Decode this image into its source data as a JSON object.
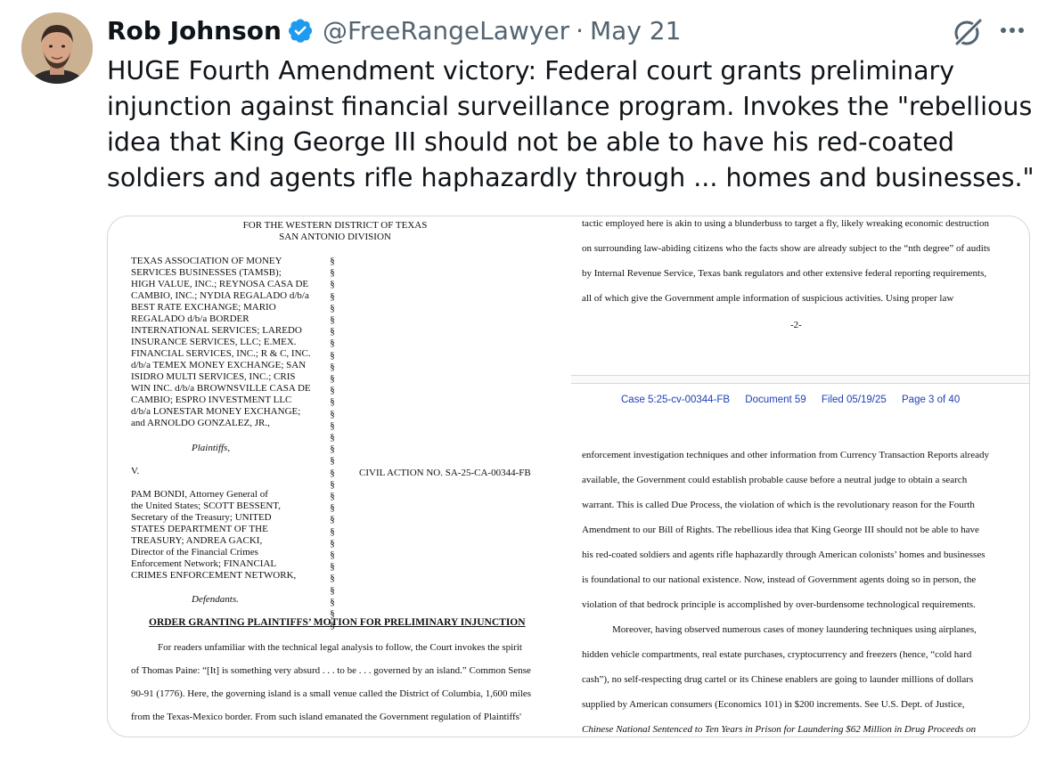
{
  "tweet": {
    "author_name": "Rob Johnson",
    "handle": "@FreeRangeLawyer",
    "separator": "·",
    "date": "May 21",
    "text": "HUGE Fourth Amendment victory: Federal court grants preliminary injunction against financial surveillance program. Invokes the \"rebellious idea that King George III should not be able to have his red-coated soldiers and agents rifle haphazardly through ... homes and businesses.\"",
    "verified_color": "#1d9bf0"
  },
  "document": {
    "court_line1": "FOR THE WESTERN DISTRICT OF TEXAS",
    "court_line2": "SAN ANTONIO DIVISION",
    "plaintiffs_lines": [
      "TEXAS ASSOCIATION OF MONEY",
      "SERVICES BUSINESSES (TAMSB);",
      "HIGH VALUE, INC.; REYNOSA CASA DE",
      "CAMBIO, INC.; NYDIA REGALADO d/b/a",
      "BEST RATE EXCHANGE; MARIO",
      "REGALADO d/b/a BORDER",
      "INTERNATIONAL SERVICES; LAREDO",
      "INSURANCE SERVICES, LLC; E.MEX.",
      "FINANCIAL SERVICES, INC.; R & C, INC.",
      "d/b/a TEMEX MONEY EXCHANGE; SAN",
      "ISIDRO MULTI SERVICES, INC.; CRIS",
      "WIN INC. d/b/a BROWNSVILLE CASA DE",
      "CAMBIO; ESPRO INVESTMENT LLC",
      "d/b/a LONESTAR MONEY EXCHANGE;",
      "and ARNOLDO GONZALEZ, JR.,"
    ],
    "plaintiffs_label": "Plaintiffs,",
    "versus": "V.",
    "civil_action": "CIVIL ACTION NO. SA-25-CA-00344-FB",
    "defendants_lines": [
      "PAM BONDI, Attorney General of",
      "the United States; SCOTT BESSENT,",
      "Secretary of the Treasury; UNITED",
      "STATES DEPARTMENT OF THE",
      "TREASURY; ANDREA GACKI,",
      "Director of the Financial Crimes",
      "Enforcement Network; FINANCIAL",
      "CRIMES ENFORCEMENT NETWORK,"
    ],
    "defendants_label": "Defendants.",
    "section_symbol": "§",
    "order_title": "ORDER GRANTING PLAINTIFFS’ MOTION FOR PRELIMINARY INJUNCTION",
    "left_body_lines": [
      "For readers unfamiliar with the technical legal analysis to follow, the Court invokes the spirit",
      "of Thomas Paine: “[It] is something very absurd . . . to be . . . governed by an island.”  Common Sense",
      "90-91 (1776).  Here, the governing island is a small venue called the District of Columbia, 1,600 miles",
      "from the Texas-Mexico border.  From such island emanated the Government regulation of Plaintiffs'"
    ],
    "right_top_lines": [
      "tactic employed here is akin to using a blunderbuss to target a fly, likely wreaking economic destruction",
      "on surrounding law-abiding citizens who the facts show are already subject to the “nth degree” of audits",
      "by Internal Revenue Service, Texas bank regulators and other extensive federal reporting requirements,",
      "all of which give the Government ample information of suspicious activities.  Using proper law"
    ],
    "page_number": "-2-",
    "case_header": {
      "case": "Case 5:25-cv-00344-FB",
      "document": "Document 59",
      "filed": "Filed 05/19/25",
      "page": "Page 3 of 40"
    },
    "right_body_lines": [
      "enforcement investigation techniques and other information from Currency Transaction Reports already",
      "available, the Government could establish probable cause before a neutral judge to obtain a search",
      "warrant. This is called Due Process, the violation of which is the revolutionary reason for the Fourth",
      "Amendment to our Bill of Rights. The rebellious idea that King George III should not be able to have",
      "his red-coated soldiers and agents rifle haphazardly through American colonists’ homes and businesses",
      "is foundational to our national existence.  Now, instead of Government agents doing so in person, the",
      "violation of that bedrock principle is accomplished by over-burdensome technological requirements.",
      "Moreover, having observed numerous cases of money laundering techniques using airplanes,",
      "hidden vehicle compartments, real estate purchases, cryptocurrency and freezers (hence, “cold hard",
      "cash”), no self-respecting drug cartel or its Chinese enablers are going to launder millions of dollars",
      "supplied by American consumers (Economics 101) in $200 increments.  See U.S. Dept. of Justice,",
      "Chinese National Sentenced to Ten Years in Prison for Laundering $62 Million in Drug Proceeds on"
    ]
  }
}
